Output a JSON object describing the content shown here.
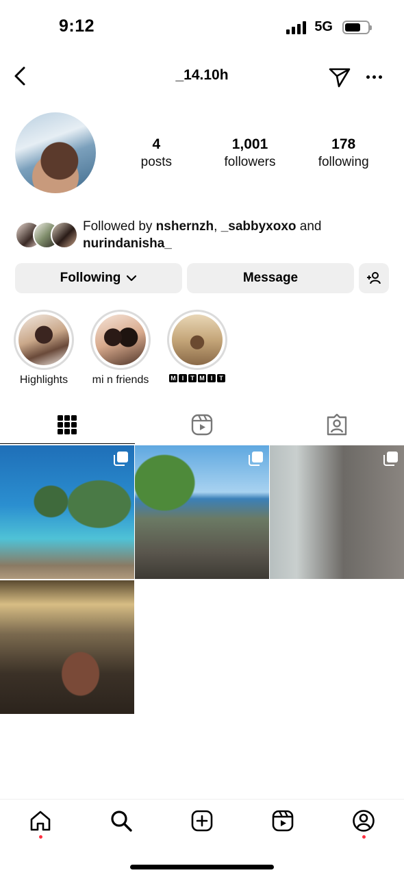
{
  "status_bar": {
    "time": "9:12",
    "network": "5G",
    "battery_level": 0.7
  },
  "header": {
    "username": "_14.10h"
  },
  "profile": {
    "stats": [
      {
        "value": "4",
        "label": "posts"
      },
      {
        "value": "1,001",
        "label": "followers"
      },
      {
        "value": "178",
        "label": "following"
      }
    ],
    "followed_by": {
      "prefix": "Followed by ",
      "user1": "nshernzh",
      "sep": ", ",
      "user2": "_sabbyxoxo",
      "conj": " and",
      "user3": "nurindanisha_"
    }
  },
  "actions": {
    "following_label": "Following",
    "message_label": "Message"
  },
  "highlights": [
    {
      "label": "Highlights"
    },
    {
      "label": "mi n friends"
    },
    {
      "label": "MITMIT",
      "letters": [
        "M",
        "I",
        "T",
        "M",
        "I",
        "T"
      ]
    }
  ],
  "tabs": [
    "grid-icon",
    "reels-icon",
    "tagged-icon"
  ],
  "posts": [
    {
      "multi": true
    },
    {
      "multi": true
    },
    {
      "multi": true
    },
    {
      "multi": false
    }
  ],
  "bottom_nav": [
    "home-icon",
    "search-icon",
    "create-icon",
    "reels-icon",
    "profile-icon"
  ],
  "colors": {
    "button_bg": "#efefef",
    "notification_dot": "#ff3040",
    "highlight_ring": "#dbdbdb"
  }
}
